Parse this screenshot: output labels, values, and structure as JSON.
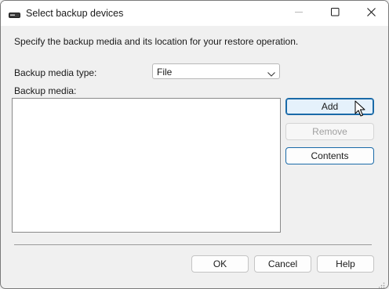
{
  "window": {
    "title": "Select backup devices",
    "icon": "backup-device-icon",
    "controls": [
      "minimize-icon",
      "maximize-icon",
      "close-icon"
    ]
  },
  "description": "Specify the backup media and its location for your restore operation.",
  "media_type": {
    "label": "Backup media type:",
    "selected": "File"
  },
  "media_list": {
    "label": "Backup media:",
    "items": []
  },
  "side_buttons": {
    "add": "Add",
    "remove": "Remove",
    "contents": "Contents"
  },
  "footer_buttons": {
    "ok": "OK",
    "cancel": "Cancel",
    "help": "Help"
  },
  "colors": {
    "accent": "#1a6aa8",
    "background": "#f0f0f0",
    "disabled_text": "#a0a0a0"
  }
}
